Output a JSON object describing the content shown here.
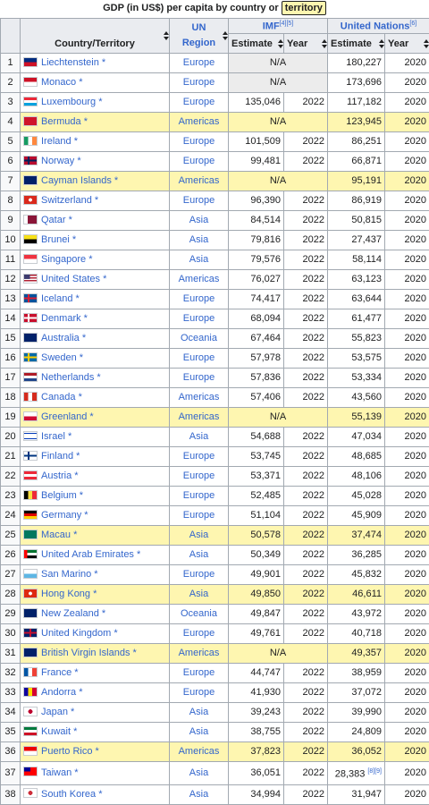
{
  "caption": {
    "prefix": "GDP (in US$) per capita by country or ",
    "tag": "territory"
  },
  "headers": {
    "country": "Country/Territory",
    "region_line1": "UN",
    "region_line2": "Region",
    "imf": "IMF",
    "imf_ref": "[4][5]",
    "un": "United Nations",
    "un_ref": "[6]",
    "estimate": "Estimate",
    "year": "Year"
  },
  "colors": {
    "link": "#3366cc",
    "highlight": "#fef6b0",
    "header_bg": "#eaecf0",
    "na_bg": "#ececec",
    "border": "#a2a9b1"
  },
  "rows": [
    {
      "rank": "1",
      "country": "Liechtenstein *",
      "region": "Europe",
      "imf_est": "N/A",
      "imf_year": "",
      "un_est": "180,227",
      "un_year": "2020",
      "hl": false,
      "flag": "liechtenstein-flag",
      "f": [
        "#002b7f",
        "#ce1126"
      ],
      "fs": "h"
    },
    {
      "rank": "2",
      "country": "Monaco *",
      "region": "Europe",
      "imf_est": "N/A",
      "imf_year": "",
      "un_est": "173,696",
      "un_year": "2020",
      "hl": false,
      "flag": "monaco-flag",
      "f": [
        "#ce1126",
        "#ffffff"
      ],
      "fs": "h"
    },
    {
      "rank": "3",
      "country": "Luxembourg *",
      "region": "Europe",
      "imf_est": "135,046",
      "imf_year": "2022",
      "un_est": "117,182",
      "un_year": "2020",
      "hl": false,
      "flag": "luxembourg-flag",
      "f": [
        "#ed2939",
        "#ffffff",
        "#00a1de"
      ],
      "fs": "h"
    },
    {
      "rank": "4",
      "country": "Bermuda *",
      "region": "Americas",
      "imf_est": "N/A",
      "imf_year": "",
      "un_est": "123,945",
      "un_year": "2020",
      "hl": true,
      "flag": "bermuda-flag",
      "f": [
        "#cf142b",
        "#cf142b"
      ],
      "fs": "h"
    },
    {
      "rank": "5",
      "country": "Ireland *",
      "region": "Europe",
      "imf_est": "101,509",
      "imf_year": "2022",
      "un_est": "86,251",
      "un_year": "2020",
      "hl": false,
      "flag": "ireland-flag",
      "f": [
        "#169b62",
        "#ffffff",
        "#ff883e"
      ],
      "fs": "v"
    },
    {
      "rank": "6",
      "country": "Norway *",
      "region": "Europe",
      "imf_est": "99,481",
      "imf_year": "2022",
      "un_est": "66,871",
      "un_year": "2020",
      "hl": false,
      "flag": "norway-flag",
      "f": [
        "#ba0c2f",
        "#00205b"
      ],
      "fs": "x"
    },
    {
      "rank": "7",
      "country": "Cayman Islands *",
      "region": "Americas",
      "imf_est": "N/A",
      "imf_year": "",
      "un_est": "95,191",
      "un_year": "2020",
      "hl": true,
      "flag": "cayman-islands-flag",
      "f": [
        "#012169",
        "#012169"
      ],
      "fs": "h"
    },
    {
      "rank": "8",
      "country": "Switzerland *",
      "region": "Europe",
      "imf_est": "96,390",
      "imf_year": "2022",
      "un_est": "86,919",
      "un_year": "2020",
      "hl": false,
      "flag": "switzerland-flag",
      "f": [
        "#da291c",
        "#da291c"
      ],
      "fs": "p"
    },
    {
      "rank": "9",
      "country": "Qatar *",
      "region": "Asia",
      "imf_est": "84,514",
      "imf_year": "2022",
      "un_est": "50,815",
      "un_year": "2020",
      "hl": false,
      "flag": "qatar-flag",
      "f": [
        "#ffffff",
        "#8a1538"
      ],
      "fs": "q"
    },
    {
      "rank": "10",
      "country": "Brunei *",
      "region": "Asia",
      "imf_est": "79,816",
      "imf_year": "2022",
      "un_est": "27,437",
      "un_year": "2020",
      "hl": false,
      "flag": "brunei-flag",
      "f": [
        "#f7e017",
        "#000000"
      ],
      "fs": "h"
    },
    {
      "rank": "11",
      "country": "Singapore *",
      "region": "Asia",
      "imf_est": "79,576",
      "imf_year": "2022",
      "un_est": "58,114",
      "un_year": "2020",
      "hl": false,
      "flag": "singapore-flag",
      "f": [
        "#ef3340",
        "#ffffff"
      ],
      "fs": "h"
    },
    {
      "rank": "12",
      "country": "United States *",
      "region": "Americas",
      "imf_est": "76,027",
      "imf_year": "2022",
      "un_est": "63,123",
      "un_year": "2020",
      "hl": false,
      "flag": "united-states-flag",
      "f": [
        "#b22234",
        "#ffffff"
      ],
      "fs": "us"
    },
    {
      "rank": "13",
      "country": "Iceland *",
      "region": "Europe",
      "imf_est": "74,417",
      "imf_year": "2022",
      "un_est": "63,644",
      "un_year": "2020",
      "hl": false,
      "flag": "iceland-flag",
      "f": [
        "#02529c",
        "#dc1e35"
      ],
      "fs": "x"
    },
    {
      "rank": "14",
      "country": "Denmark *",
      "region": "Europe",
      "imf_est": "68,094",
      "imf_year": "2022",
      "un_est": "61,477",
      "un_year": "2020",
      "hl": false,
      "flag": "denmark-flag",
      "f": [
        "#c8102e",
        "#ffffff"
      ],
      "fs": "x"
    },
    {
      "rank": "15",
      "country": "Australia *",
      "region": "Oceania",
      "imf_est": "67,464",
      "imf_year": "2022",
      "un_est": "55,823",
      "un_year": "2020",
      "hl": false,
      "flag": "australia-flag",
      "f": [
        "#012169",
        "#012169"
      ],
      "fs": "h"
    },
    {
      "rank": "16",
      "country": "Sweden *",
      "region": "Europe",
      "imf_est": "57,978",
      "imf_year": "2022",
      "un_est": "53,575",
      "un_year": "2020",
      "hl": false,
      "flag": "sweden-flag",
      "f": [
        "#006aa7",
        "#fecc00"
      ],
      "fs": "x"
    },
    {
      "rank": "17",
      "country": "Netherlands *",
      "region": "Europe",
      "imf_est": "57,836",
      "imf_year": "2022",
      "un_est": "53,334",
      "un_year": "2020",
      "hl": false,
      "flag": "netherlands-flag",
      "f": [
        "#ae1c28",
        "#ffffff",
        "#21468b"
      ],
      "fs": "h"
    },
    {
      "rank": "18",
      "country": "Canada *",
      "region": "Americas",
      "imf_est": "57,406",
      "imf_year": "2022",
      "un_est": "43,560",
      "un_year": "2020",
      "hl": false,
      "flag": "canada-flag",
      "f": [
        "#d52b1e",
        "#ffffff",
        "#d52b1e"
      ],
      "fs": "v"
    },
    {
      "rank": "19",
      "country": "Greenland *",
      "region": "Americas",
      "imf_est": "N/A",
      "imf_year": "",
      "un_est": "55,139",
      "un_year": "2020",
      "hl": true,
      "flag": "greenland-flag",
      "f": [
        "#ffffff",
        "#d00c33"
      ],
      "fs": "h"
    },
    {
      "rank": "20",
      "country": "Israel *",
      "region": "Asia",
      "imf_est": "54,688",
      "imf_year": "2022",
      "un_est": "47,034",
      "un_year": "2020",
      "hl": false,
      "flag": "israel-flag",
      "f": [
        "#ffffff",
        "#0038b8"
      ],
      "fs": "il"
    },
    {
      "rank": "21",
      "country": "Finland *",
      "region": "Europe",
      "imf_est": "53,745",
      "imf_year": "2022",
      "un_est": "48,685",
      "un_year": "2020",
      "hl": false,
      "flag": "finland-flag",
      "f": [
        "#ffffff",
        "#003580"
      ],
      "fs": "x"
    },
    {
      "rank": "22",
      "country": "Austria *",
      "region": "Europe",
      "imf_est": "53,371",
      "imf_year": "2022",
      "un_est": "48,106",
      "un_year": "2020",
      "hl": false,
      "flag": "austria-flag",
      "f": [
        "#ed2939",
        "#ffffff",
        "#ed2939"
      ],
      "fs": "h"
    },
    {
      "rank": "23",
      "country": "Belgium *",
      "region": "Europe",
      "imf_est": "52,485",
      "imf_year": "2022",
      "un_est": "45,028",
      "un_year": "2020",
      "hl": false,
      "flag": "belgium-flag",
      "f": [
        "#000000",
        "#fae042",
        "#ed2939"
      ],
      "fs": "v"
    },
    {
      "rank": "24",
      "country": "Germany *",
      "region": "Europe",
      "imf_est": "51,104",
      "imf_year": "2022",
      "un_est": "45,909",
      "un_year": "2020",
      "hl": false,
      "flag": "germany-flag",
      "f": [
        "#000000",
        "#dd0000",
        "#ffce00"
      ],
      "fs": "h"
    },
    {
      "rank": "25",
      "country": "Macau *",
      "region": "Asia",
      "imf_est": "50,578",
      "imf_year": "2022",
      "un_est": "37,474",
      "un_year": "2020",
      "hl": true,
      "flag": "macau-flag",
      "f": [
        "#00785e",
        "#00785e"
      ],
      "fs": "h"
    },
    {
      "rank": "26",
      "country": "United Arab Emirates *",
      "region": "Asia",
      "imf_est": "50,349",
      "imf_year": "2022",
      "un_est": "36,285",
      "un_year": "2020",
      "hl": false,
      "flag": "uae-flag",
      "f": [
        "#00732f",
        "#ffffff",
        "#000000"
      ],
      "fs": "ae"
    },
    {
      "rank": "27",
      "country": "San Marino *",
      "region": "Europe",
      "imf_est": "49,901",
      "imf_year": "2022",
      "un_est": "45,832",
      "un_year": "2020",
      "hl": false,
      "flag": "san-marino-flag",
      "f": [
        "#ffffff",
        "#5eb6e4"
      ],
      "fs": "h"
    },
    {
      "rank": "28",
      "country": "Hong Kong *",
      "region": "Asia",
      "imf_est": "49,850",
      "imf_year": "2022",
      "un_est": "46,611",
      "un_year": "2020",
      "hl": true,
      "flag": "hong-kong-flag",
      "f": [
        "#de2910",
        "#de2910"
      ],
      "fs": "p"
    },
    {
      "rank": "29",
      "country": "New Zealand *",
      "region": "Oceania",
      "imf_est": "49,847",
      "imf_year": "2022",
      "un_est": "43,972",
      "un_year": "2020",
      "hl": false,
      "flag": "new-zealand-flag",
      "f": [
        "#012169",
        "#012169"
      ],
      "fs": "h"
    },
    {
      "rank": "30",
      "country": "United Kingdom *",
      "region": "Europe",
      "imf_est": "49,761",
      "imf_year": "2022",
      "un_est": "40,718",
      "un_year": "2020",
      "hl": false,
      "flag": "united-kingdom-flag",
      "f": [
        "#012169",
        "#c8102e"
      ],
      "fs": "uk"
    },
    {
      "rank": "31",
      "country": "British Virgin Islands *",
      "region": "Americas",
      "imf_est": "N/A",
      "imf_year": "",
      "un_est": "49,357",
      "un_year": "2020",
      "hl": true,
      "flag": "british-virgin-islands-flag",
      "f": [
        "#012169",
        "#012169"
      ],
      "fs": "h"
    },
    {
      "rank": "32",
      "country": "France *",
      "region": "Europe",
      "imf_est": "44,747",
      "imf_year": "2022",
      "un_est": "38,959",
      "un_year": "2020",
      "hl": false,
      "flag": "france-flag",
      "f": [
        "#0055a4",
        "#ffffff",
        "#ef4135"
      ],
      "fs": "v"
    },
    {
      "rank": "33",
      "country": "Andorra *",
      "region": "Europe",
      "imf_est": "41,930",
      "imf_year": "2022",
      "un_est": "37,072",
      "un_year": "2020",
      "hl": false,
      "flag": "andorra-flag",
      "f": [
        "#10069f",
        "#fedd00",
        "#d50032"
      ],
      "fs": "v"
    },
    {
      "rank": "34",
      "country": "Japan *",
      "region": "Asia",
      "imf_est": "39,243",
      "imf_year": "2022",
      "un_est": "39,990",
      "un_year": "2020",
      "hl": false,
      "flag": "japan-flag",
      "f": [
        "#ffffff",
        "#bc002d"
      ],
      "fs": "jp"
    },
    {
      "rank": "35",
      "country": "Kuwait *",
      "region": "Asia",
      "imf_est": "38,755",
      "imf_year": "2022",
      "un_est": "24,809",
      "un_year": "2020",
      "hl": false,
      "flag": "kuwait-flag",
      "f": [
        "#007a3d",
        "#ffffff",
        "#ce1126"
      ],
      "fs": "h"
    },
    {
      "rank": "36",
      "country": "Puerto Rico *",
      "region": "Americas",
      "imf_est": "37,823",
      "imf_year": "2022",
      "un_est": "36,052",
      "un_year": "2020",
      "hl": true,
      "flag": "puerto-rico-flag",
      "f": [
        "#ed0000",
        "#ffffff"
      ],
      "fs": "h"
    },
    {
      "rank": "37",
      "country": "Taiwan *",
      "region": "Asia",
      "imf_est": "36,051",
      "imf_year": "2022",
      "un_est": "28,383",
      "un_year": "2020",
      "un_ref": "[8][9]",
      "hl": false,
      "flag": "taiwan-flag",
      "f": [
        "#fe0000",
        "#000095"
      ],
      "fs": "tw"
    },
    {
      "rank": "38",
      "country": "South Korea *",
      "region": "Asia",
      "imf_est": "34,994",
      "imf_year": "2022",
      "un_est": "31,947",
      "un_year": "2020",
      "hl": false,
      "flag": "south-korea-flag",
      "f": [
        "#ffffff",
        "#cd2e3a"
      ],
      "fs": "jp"
    }
  ]
}
